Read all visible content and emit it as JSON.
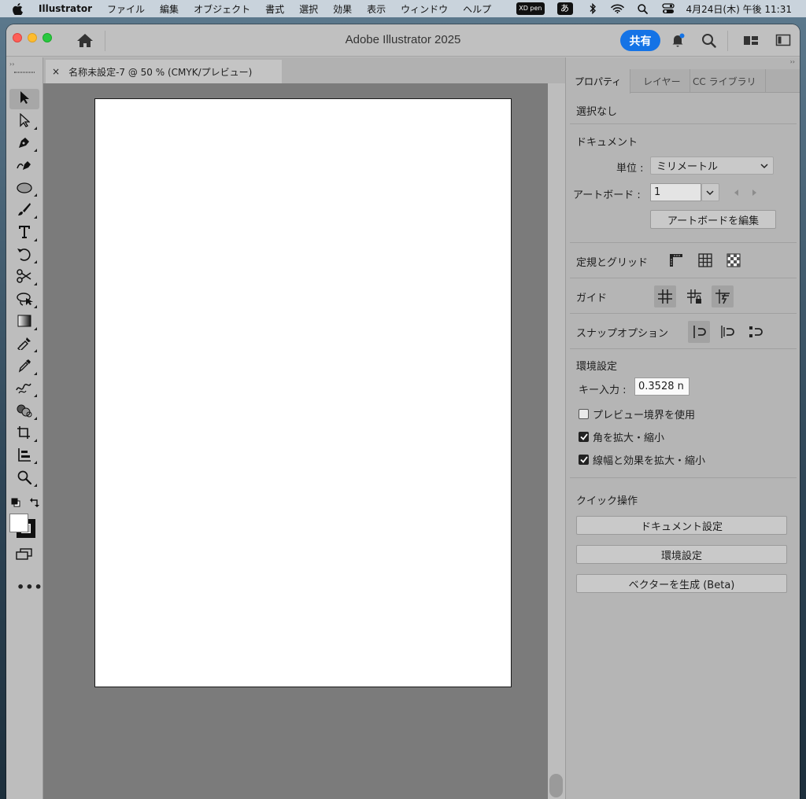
{
  "menubar": {
    "app_name": "Illustrator",
    "items": [
      "ファイル",
      "編集",
      "オブジェクト",
      "書式",
      "選択",
      "効果",
      "表示",
      "ウィンドウ",
      "ヘルプ"
    ],
    "status": {
      "badge_text": "XD pen",
      "ime": "あ",
      "clock": "4月24日(木) 午後 11:31"
    }
  },
  "window": {
    "title": "Adobe Illustrator 2025",
    "share_label": "共有"
  },
  "document": {
    "tab_label": "名称未設定-7 @ 50 % (CMYK/プレビュー)",
    "close_glyph": "×"
  },
  "panel": {
    "tabs": [
      "プロパティ",
      "レイヤー",
      "CC ライブラリ"
    ],
    "selection_text": "選択なし",
    "document_section": {
      "title": "ドキュメント",
      "units_label": "単位 :",
      "units_value": "ミリメートル",
      "artboard_label": "アートボード :",
      "artboard_value": "1",
      "edit_artboards_button": "アートボードを編集"
    },
    "rulers_grids": {
      "title": "定規とグリッド"
    },
    "guides": {
      "title": "ガイド"
    },
    "snap_options": {
      "title": "スナップオプション"
    },
    "preferences": {
      "title": "環境設定",
      "keyboard_increment_label": "キー入力 :",
      "keyboard_increment_value": "0.3528 n",
      "checkboxes": [
        {
          "label": "プレビュー境界を使用",
          "checked": false
        },
        {
          "label": "角を拡大・縮小",
          "checked": true
        },
        {
          "label": "線幅と効果を拡大・縮小",
          "checked": true
        }
      ]
    },
    "quick_actions": {
      "title": "クイック操作",
      "buttons": [
        "ドキュメント設定",
        "環境設定",
        "ベクターを生成 (Beta)"
      ]
    }
  },
  "colors": {
    "share_blue": "#1473e6",
    "panel_bg": "#b5b5b5",
    "canvas_bg": "#7b7b7b"
  },
  "icons": {
    "toolbar": [
      "selection-tool-icon",
      "direct-selection-tool-icon",
      "pen-tool-icon",
      "curvature-tool-icon",
      "ellipse-tool-icon",
      "paintbrush-tool-icon",
      "type-tool-icon",
      "rotate-tool-icon",
      "scissors-tool-icon",
      "lasso-tool-icon",
      "gradient-tool-icon",
      "eyedropper-tool-icon",
      "blend-tool-icon",
      "symbol-sprayer-tool-icon",
      "shape-builder-tool-icon",
      "artboard-tool-icon",
      "graph-tool-icon",
      "zoom-tool-icon",
      "swap-colors-icon",
      "default-colors-icon",
      "change-screen-mode-icon",
      "more-tools-icon"
    ]
  }
}
